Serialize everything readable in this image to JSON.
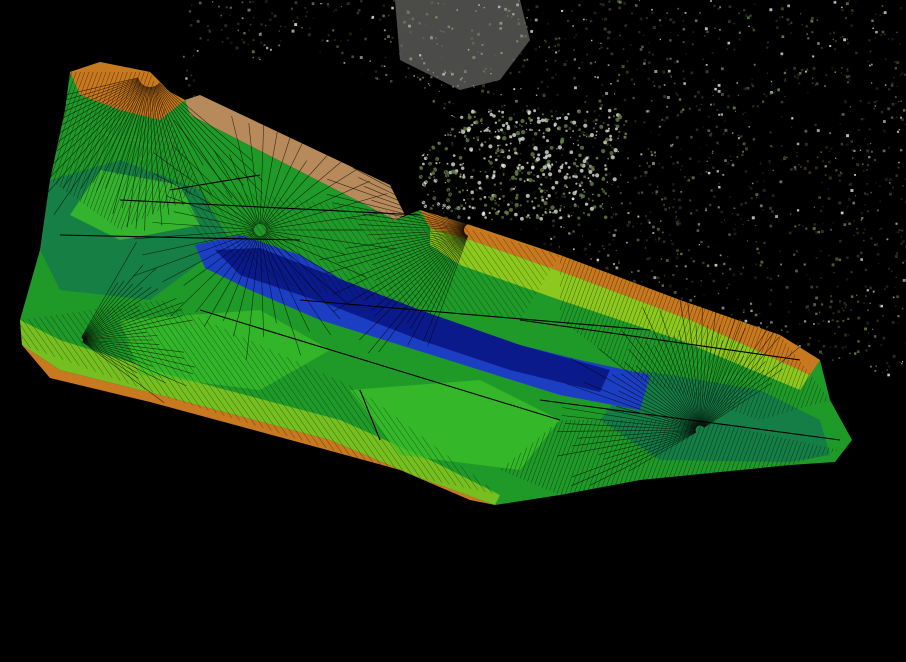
{
  "scene": {
    "background": "#000000",
    "colors": {
      "deep": "#0a1a8a",
      "mid_blue": "#1c3ec2",
      "teal": "#0f6a5a",
      "green": "#1f9a28",
      "bright_green": "#3cc02a",
      "yellow_green": "#8cc81e",
      "orange": "#c8781e",
      "brown": "#9a5a1a",
      "mesh_line": "#000000",
      "pointcloud_light": "#c9c9bf",
      "pointcloud_dark": "#3a3326",
      "vegetation": "#5e7a3a",
      "building": "#d8d8d0"
    },
    "layers": [
      {
        "name": "surface-mesh-layer"
      },
      {
        "name": "point-cloud-layer"
      },
      {
        "name": "reservoir-water-layer"
      }
    ]
  }
}
